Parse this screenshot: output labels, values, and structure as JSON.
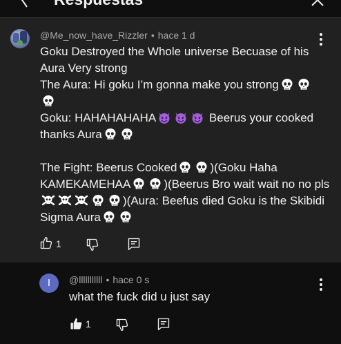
{
  "header": {
    "title": "Respuestas",
    "back_icon": "back-arrow-icon",
    "close_icon": "close-icon"
  },
  "comment": {
    "author": "@Me_now_have_Rizzler",
    "separator": "•",
    "time": "hace 1 d",
    "lines": [
      "Goku Destroyed the Whole universe Becuase of his Aura Very strong",
      "The Aura: Hi goku I’m gonna make you strong",
      "Goku: HAHAHAHAHA",
      "Beerus your cooked thanks Aura",
      "The Fight: Beerus Cooked",
      ")(Goku Haha KAMEKAMEHAA",
      ")(Beerus Bro wait wait no no pls",
      ")(Aura: Beefus died Goku is the Skibidi Sigma Aura"
    ],
    "emoji": {
      "skull": "skull-emoji",
      "devil": "smiling-devil-emoji",
      "crossbones": "skull-crossbones-emoji"
    },
    "like_count": "1",
    "icons": [
      "thumbs-up-icon",
      "thumbs-down-icon",
      "reply-icon",
      "more-vert-icon"
    ]
  },
  "reply": {
    "avatar_letter": "I",
    "author": "@lllllllllll",
    "separator": "•",
    "time": "hace 0 s",
    "text": "what the fuck did u just say",
    "like_count": "1",
    "icons": [
      "thumbs-up-filled-icon",
      "thumbs-down-icon",
      "reply-icon",
      "more-vert-icon"
    ]
  },
  "colors": {
    "background": "#0f0f0f",
    "highlight_background": "#212121",
    "secondary_text": "#aaaaaa",
    "reply_avatar": "#5c6bc0"
  }
}
